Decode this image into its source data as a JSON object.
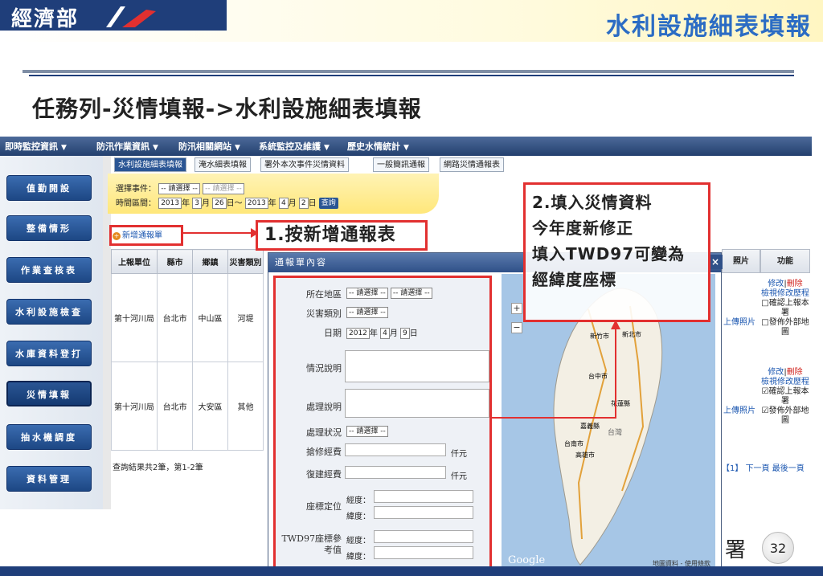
{
  "slide": {
    "logo": "經濟部",
    "title": "水利設施細表填報",
    "breadcrumb": "任務列-災情填報->水利設施細表填報",
    "page_number": "32",
    "partial_char": "署"
  },
  "topnav": [
    "即時監控資訊",
    "防汛作業資訊",
    "防汛相關網站",
    "系統監控及維護",
    "歷史水情統計"
  ],
  "sidebar": [
    "值勤開設",
    "整備情形",
    "作業查核表",
    "水利設施檢查",
    "水庫資料登打",
    "災情填報",
    "抽水機調度",
    "資料管理"
  ],
  "sidebar_active_index": 5,
  "tabs": [
    "水利設施細表填報",
    "淹水細表填報",
    "署外本次事件災情資料",
    "一般簡訊通報",
    "網路災情通報表"
  ],
  "tabs_active_index": 0,
  "filter": {
    "event_label": "選擇事件：",
    "event_select1": "-- 請選擇 --",
    "event_select2": "-- 請選擇 --",
    "range_label": "時間區間：",
    "y1": "2013",
    "m1": "3",
    "d1": "26",
    "tilde": "日～",
    "y2": "2013",
    "m2": "4",
    "d2": "2",
    "query": "查詢"
  },
  "add_link": "新增通報單",
  "grid": {
    "headers": [
      "上報單位",
      "縣市",
      "鄉鎮",
      "災害類別"
    ],
    "rows": [
      [
        "第十河川局",
        "台北市",
        "中山區",
        "河堤"
      ],
      [
        "第十河川局",
        "台北市",
        "大安區",
        "其他"
      ]
    ],
    "right_headers": [
      "照片",
      "功能"
    ],
    "photo_link": "上傳照片",
    "func1": {
      "edit": "修改",
      "sep": "|",
      "delete": "刪除",
      "history": "檢視修改歷程",
      "opt1": "□確認上報本署",
      "opt2": "□發佈外部地圖"
    },
    "func2": {
      "edit": "修改",
      "sep": "|",
      "delete": "刪除",
      "history": "檢視修改歷程",
      "opt1": "☑確認上報本署",
      "opt2": "☑發佈外部地圖"
    }
  },
  "result_text": "查詢結果共2筆，第1-2筆",
  "pager": {
    "page": "1",
    "next": "下一頁",
    "last": "最後一頁"
  },
  "modal": {
    "title": "通報單內容",
    "close": "×",
    "fields": {
      "region_label": "所在地區",
      "region_sel1": "-- 請選擇 --",
      "region_sel2": "-- 請選擇 --",
      "type_label": "災害類別",
      "type_sel": "-- 請選擇 --",
      "date_label": "日期",
      "date_value": "2012",
      "date_year": "年",
      "date_month_val": "4",
      "date_month": "月",
      "date_day_val": "9",
      "date_day": "日",
      "situation_label": "情況說明",
      "handling_label": "處理說明",
      "status_label": "處理狀況",
      "status_sel": "-- 請選擇 --",
      "repair_label": "搶修經費",
      "rebuild_label": "復建經費",
      "unit": "仟元",
      "coord_label": "座標定位",
      "lng": "經度：",
      "lat": "緯度：",
      "twd97_label": "TWD97座標參考值",
      "twd97_lng": "經度：",
      "twd97_lat": "緯度："
    },
    "map": {
      "google": "Google",
      "attribution": "地圖資料 - 使用條款",
      "places": [
        "新竹市",
        "新北市",
        "台中市",
        "花蓮縣",
        "台南市",
        "高雄市",
        "嘉義縣",
        "台灣"
      ]
    }
  },
  "callouts": {
    "step1": "1.按新增通報表",
    "step2_title": "2.填入災情資料",
    "step2_line2": "今年度新修正",
    "step2_line3": "填入TWD97可變為經緯度座標"
  },
  "colors": {
    "accent_red": "#e23030",
    "nav_blue": "#1f3e7a",
    "title_blue": "#2b6cc4"
  }
}
